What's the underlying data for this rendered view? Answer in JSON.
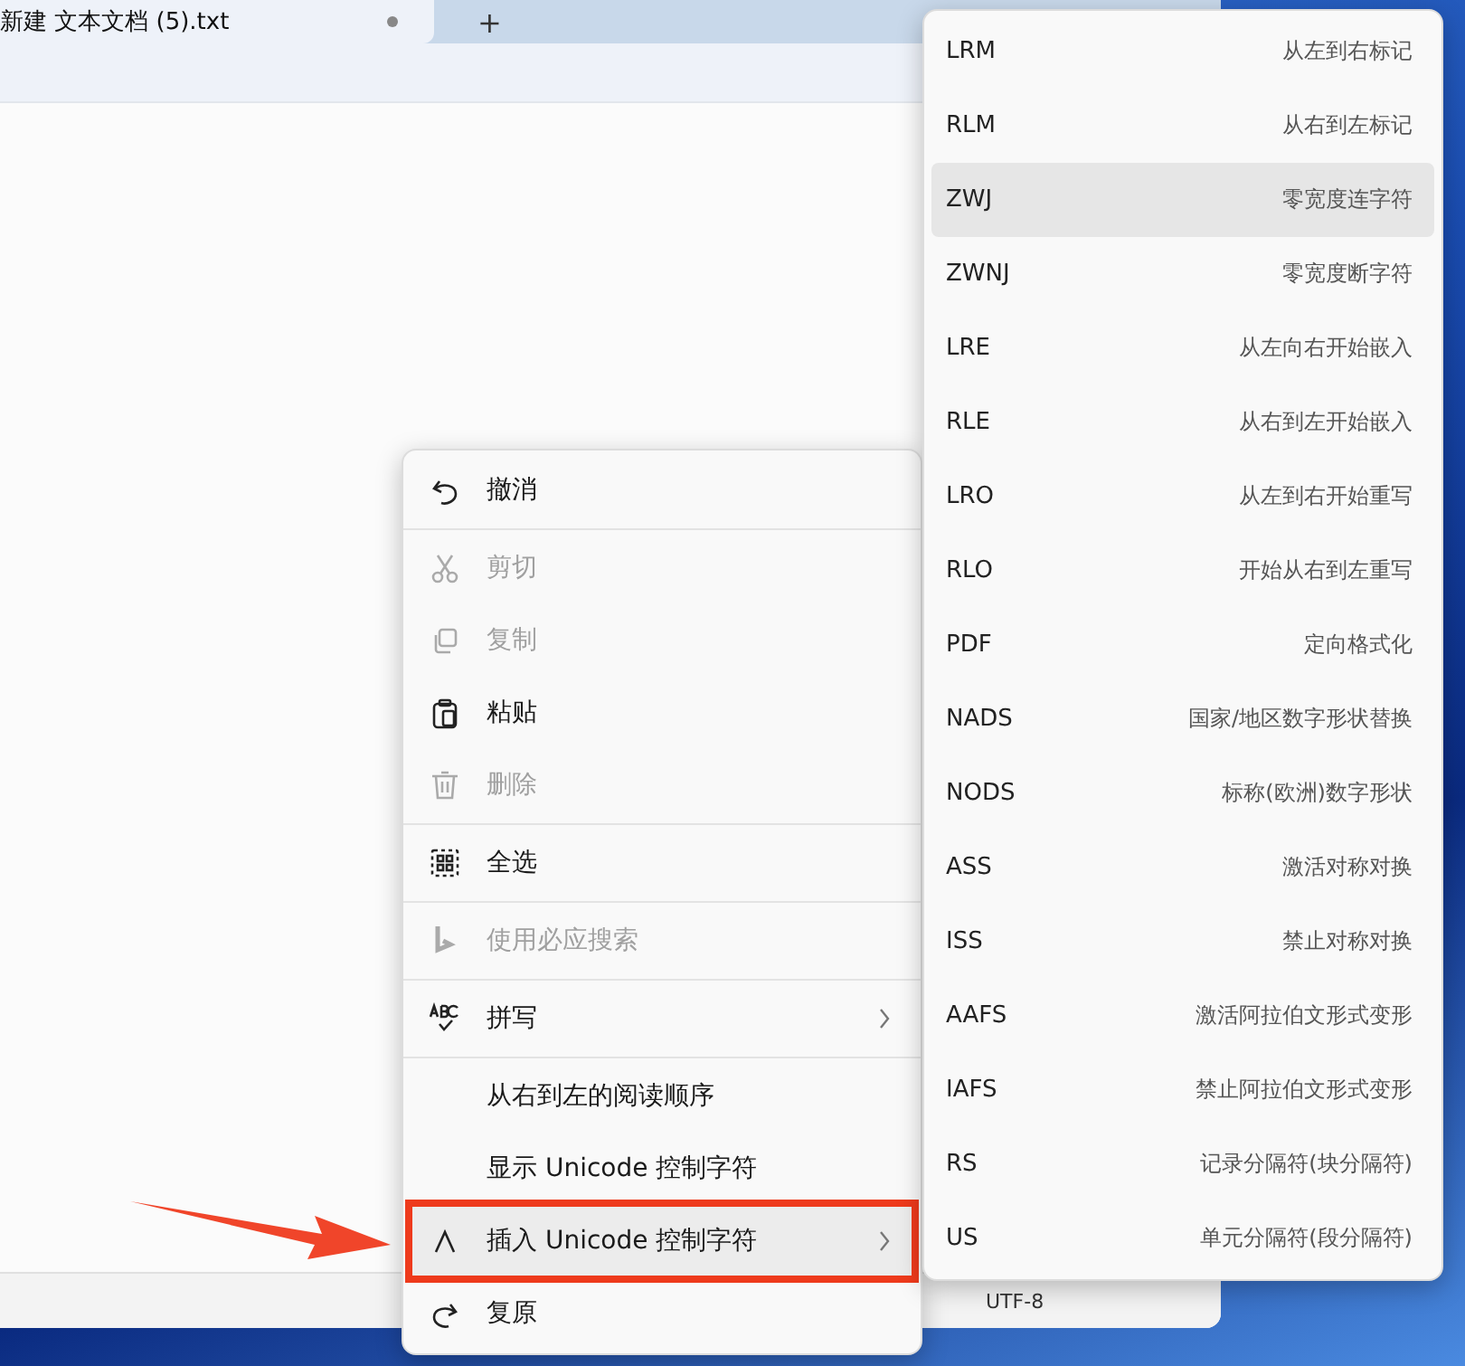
{
  "window": {
    "tab": {
      "title": "新建 文本文档 (5).txt",
      "modified": true,
      "selected": true
    },
    "new_tab": "+",
    "status_bar": {
      "encoding": "UTF-8"
    }
  },
  "context_menu": [
    {
      "kind": "item",
      "label": "撤消",
      "disabled": false,
      "submenu": false,
      "selected": false,
      "annotated": false
    },
    {
      "kind": "divider"
    },
    {
      "kind": "item",
      "label": "剪切",
      "disabled": true,
      "submenu": false,
      "selected": false,
      "annotated": false
    },
    {
      "kind": "item",
      "label": "复制",
      "disabled": true,
      "submenu": false,
      "selected": false,
      "annotated": false
    },
    {
      "kind": "item",
      "label": "粘贴",
      "disabled": false,
      "submenu": false,
      "selected": false,
      "annotated": false
    },
    {
      "kind": "item",
      "label": "删除",
      "disabled": true,
      "submenu": false,
      "selected": false,
      "annotated": false
    },
    {
      "kind": "divider"
    },
    {
      "kind": "item",
      "label": "全选",
      "disabled": false,
      "submenu": false,
      "selected": false,
      "annotated": false
    },
    {
      "kind": "divider"
    },
    {
      "kind": "item",
      "label": "使用必应搜索",
      "disabled": true,
      "submenu": false,
      "selected": false,
      "annotated": false
    },
    {
      "kind": "divider"
    },
    {
      "kind": "item",
      "label": "拼写",
      "disabled": false,
      "submenu": true,
      "selected": false,
      "annotated": false
    },
    {
      "kind": "divider"
    },
    {
      "kind": "item",
      "label": "从右到左的阅读顺序",
      "disabled": false,
      "submenu": false,
      "selected": false,
      "annotated": false
    },
    {
      "kind": "item",
      "label": "显示 Unicode 控制字符",
      "disabled": false,
      "submenu": false,
      "selected": false,
      "annotated": false
    },
    {
      "kind": "item",
      "label": "插入 Unicode 控制字符",
      "disabled": false,
      "submenu": true,
      "selected": true,
      "annotated": true
    },
    {
      "kind": "item",
      "label": "复原",
      "disabled": false,
      "submenu": false,
      "selected": false,
      "annotated": false
    }
  ],
  "submenu": [
    {
      "code": "LRM",
      "description": "从左到右标记",
      "selected": false
    },
    {
      "code": "RLM",
      "description": "从右到左标记",
      "selected": false
    },
    {
      "code": "ZWJ",
      "description": "零宽度连字符",
      "selected": true
    },
    {
      "code": "ZWNJ",
      "description": "零宽度断字符",
      "selected": false
    },
    {
      "code": "LRE",
      "description": "从左向右开始嵌入",
      "selected": false
    },
    {
      "code": "RLE",
      "description": "从右到左开始嵌入",
      "selected": false
    },
    {
      "code": "LRO",
      "description": "从左到右开始重写",
      "selected": false
    },
    {
      "code": "RLO",
      "description": "开始从右到左重写",
      "selected": false
    },
    {
      "code": "PDF",
      "description": "定向格式化",
      "selected": false
    },
    {
      "code": "NADS",
      "description": "国家/地区数字形状替换",
      "selected": false
    },
    {
      "code": "NODS",
      "description": "标称(欧洲)数字形状",
      "selected": false
    },
    {
      "code": "ASS",
      "description": "激活对称对换",
      "selected": false
    },
    {
      "code": "ISS",
      "description": "禁止对称对换",
      "selected": false
    },
    {
      "code": "AAFS",
      "description": "激活阿拉伯文形式变形",
      "selected": false
    },
    {
      "code": "IAFS",
      "description": "禁止阿拉伯文形式变形",
      "selected": false
    },
    {
      "code": "RS",
      "description": "记录分隔符(块分隔符)",
      "selected": false
    },
    {
      "code": "US",
      "description": "单元分隔符(段分隔符)",
      "selected": false
    }
  ]
}
